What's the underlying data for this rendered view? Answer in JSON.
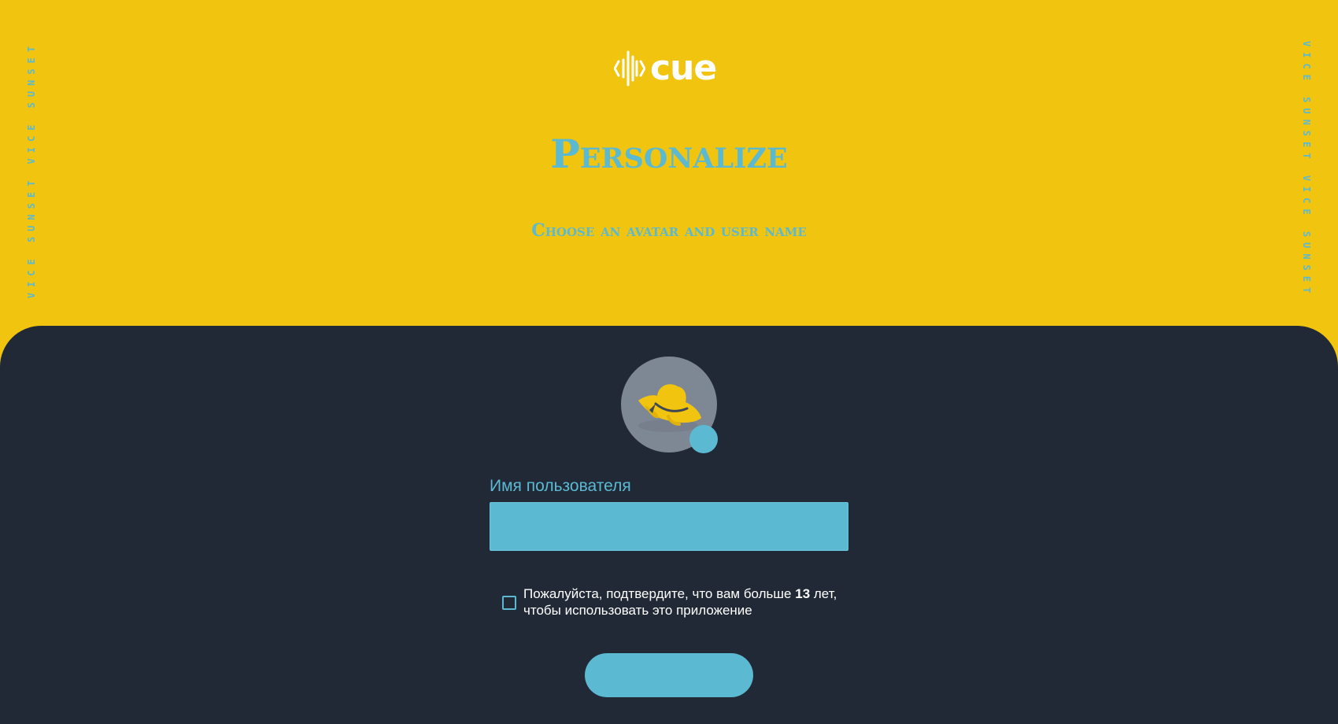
{
  "brand": {
    "logo_text": "cue",
    "side_text": "VICE SUNSET VICE SUNSET"
  },
  "header": {
    "title": "Personalize",
    "subtitle": "Choose an avatar and user name"
  },
  "avatar": {
    "image_icon": "sun-hat-icon",
    "edit_icon": "edit-avatar-dot-icon"
  },
  "form": {
    "username_label": "Имя пользователя",
    "username_value": "",
    "username_placeholder": "",
    "age_consent_prefix": "Пожалуйста, подтвердите, что вам больше ",
    "age_consent_age": "13",
    "age_consent_suffix": " лет, чтобы использовать это приложение",
    "age_consent_checked": false,
    "submit_label": ""
  },
  "colors": {
    "top_background": "#f0c40f",
    "panel_background": "#212836",
    "accent": "#5bbad2",
    "avatar_background": "#7e8794",
    "text_light": "#ffffff"
  }
}
